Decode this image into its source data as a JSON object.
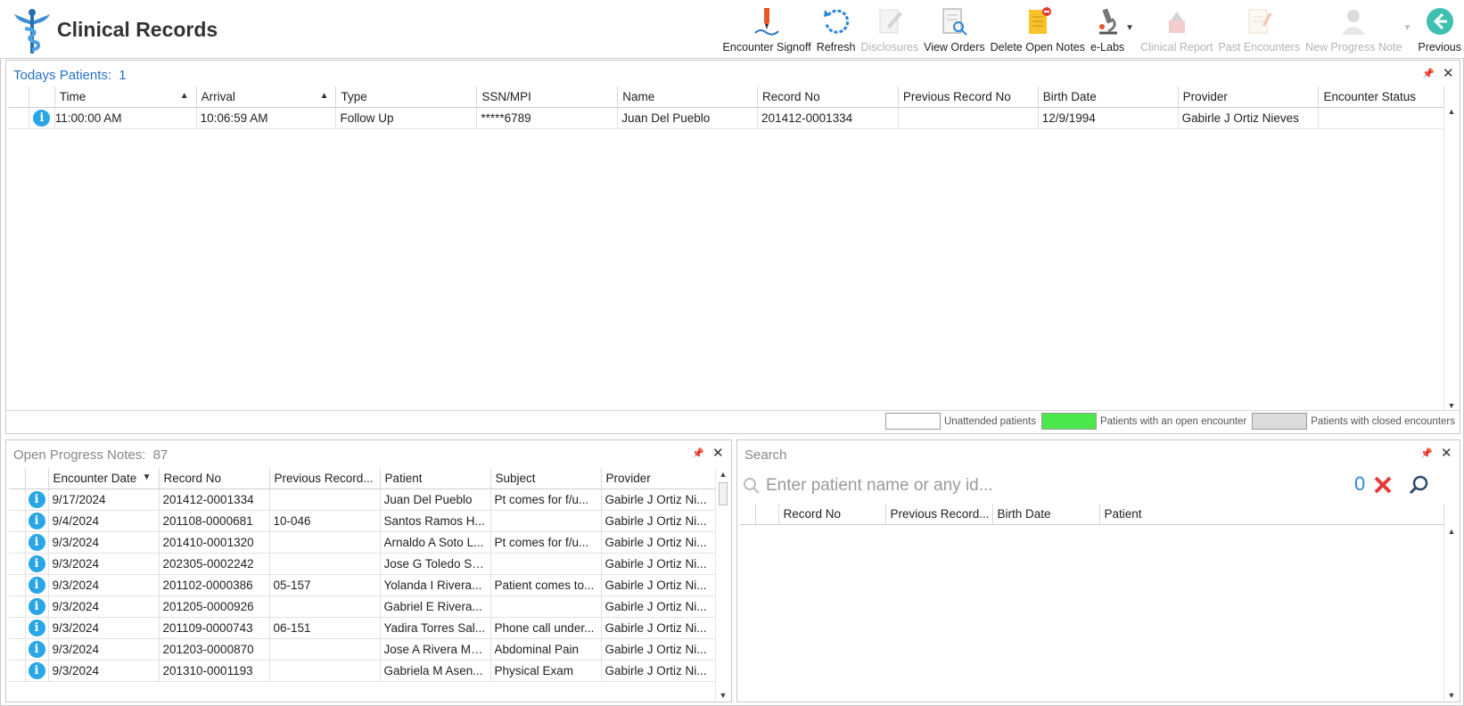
{
  "app": {
    "title": "Clinical Records"
  },
  "toolbar": {
    "encounter_signoff": "Encounter Signoff",
    "refresh": "Refresh",
    "disclosures": "Disclosures",
    "view_orders": "View Orders",
    "delete_open_notes": "Delete Open Notes",
    "elabs": "e-Labs",
    "clinical_report": "Clinical Report",
    "past_encounters": "Past Encounters",
    "new_progress_note": "New Progress Note",
    "previous": "Previous"
  },
  "todays_patients": {
    "title": "Todays Patients:",
    "count": "1",
    "columns": [
      "Time",
      "Arrival",
      "Type",
      "SSN/MPI",
      "Name",
      "Record No",
      "Previous Record No",
      "Birth Date",
      "Provider",
      "Encounter Status"
    ],
    "rows": [
      {
        "time": "11:00:00 AM",
        "arrival": "10:06:59 AM",
        "type": "Follow Up",
        "ssn": "*****6789",
        "name": "Juan Del Pueblo",
        "record_no": "201412-0001334",
        "prev_record_no": "",
        "birth_date": "12/9/1994",
        "provider": "Gabirle J Ortiz Nieves",
        "status": ""
      }
    ]
  },
  "legend": {
    "unattended": "Unattended patients",
    "open": "Patients with an open encounter",
    "closed": "Patients with closed encounters",
    "colors": {
      "unattended": "#ffffff",
      "open": "#4ae84a",
      "closed": "#dcdcdc"
    }
  },
  "open_notes": {
    "title": "Open Progress Notes:",
    "count": "87",
    "columns": [
      "Encounter Date",
      "Record No",
      "Previous Record...",
      "Patient",
      "Subject",
      "Provider"
    ],
    "rows": [
      {
        "date": "9/17/2024",
        "record_no": "201412-0001334",
        "prev": "",
        "patient": "Juan Del Pueblo",
        "subject": "Pt comes for f/u...",
        "provider": "Gabirle J Ortiz Ni..."
      },
      {
        "date": "9/4/2024",
        "record_no": "201108-0000681",
        "prev": "10-046",
        "patient": "Santos Ramos H...",
        "subject": "",
        "provider": "Gabirle J Ortiz Ni..."
      },
      {
        "date": "9/3/2024",
        "record_no": "201410-0001320",
        "prev": "",
        "patient": "Arnaldo A Soto L...",
        "subject": "Pt comes for f/u...",
        "provider": "Gabirle J Ortiz Ni..."
      },
      {
        "date": "9/3/2024",
        "record_no": "202305-0002242",
        "prev": "",
        "patient": "Jose G Toledo Sa...",
        "subject": "",
        "provider": "Gabirle J Ortiz Ni..."
      },
      {
        "date": "9/3/2024",
        "record_no": "201102-0000386",
        "prev": "05-157",
        "patient": "Yolanda I Rivera...",
        "subject": "Patient comes to...",
        "provider": "Gabirle J Ortiz Ni..."
      },
      {
        "date": "9/3/2024",
        "record_no": "201205-0000926",
        "prev": "",
        "patient": "Gabriel E Rivera...",
        "subject": "",
        "provider": "Gabirle J Ortiz Ni..."
      },
      {
        "date": "9/3/2024",
        "record_no": "201109-0000743",
        "prev": "06-151",
        "patient": "Yadira Torres Sal...",
        "subject": "Phone call under...",
        "provider": "Gabirle J Ortiz Ni..."
      },
      {
        "date": "9/3/2024",
        "record_no": "201203-0000870",
        "prev": "",
        "patient": "Jose A Rivera Ma...",
        "subject": "Abdominal Pain",
        "provider": "Gabirle J Ortiz Ni..."
      },
      {
        "date": "9/3/2024",
        "record_no": "201310-0001193",
        "prev": "",
        "patient": "Gabriela M Asen...",
        "subject": "Physical Exam",
        "provider": "Gabirle J Ortiz Ni..."
      }
    ]
  },
  "search": {
    "title": "Search",
    "placeholder": "Enter patient name or any id...",
    "result_count": "0",
    "columns": [
      "Record No",
      "Previous Record...",
      "Birth Date",
      "Patient"
    ]
  },
  "colors": {
    "accent_blue": "#2a73c5",
    "info_blue": "#29a6e8",
    "clear_red": "#e53935"
  }
}
